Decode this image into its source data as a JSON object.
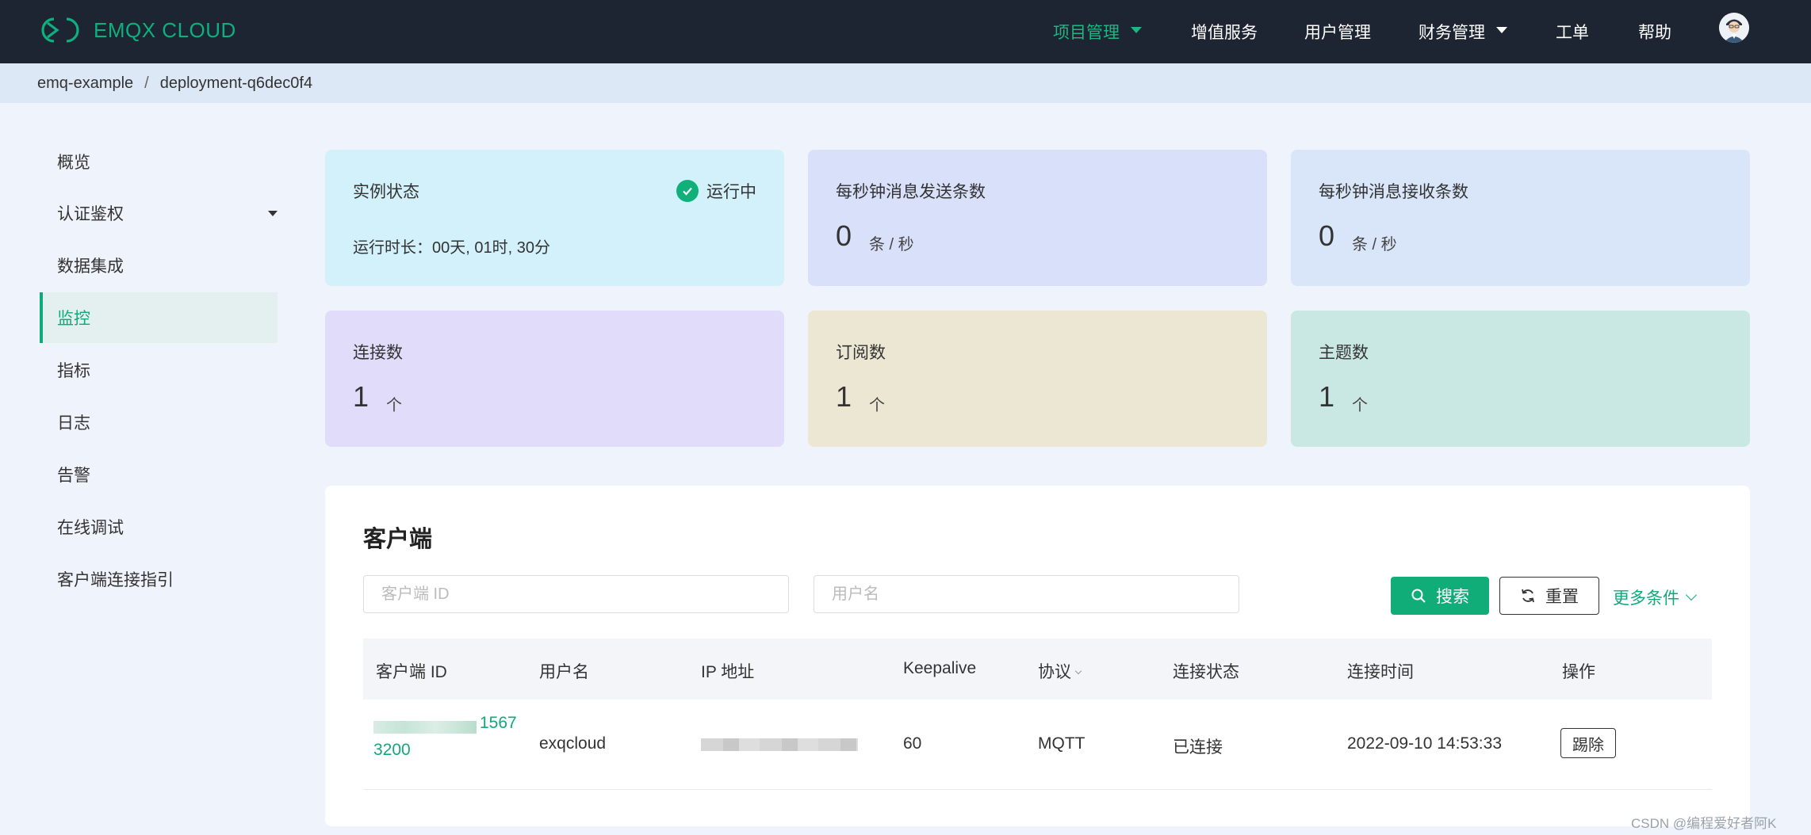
{
  "brand": {
    "name": "EMQX CLOUD",
    "color": "#0db07e"
  },
  "nav": {
    "items": [
      {
        "label": "项目管理",
        "dropdown": true,
        "active": true
      },
      {
        "label": "增值服务",
        "dropdown": false
      },
      {
        "label": "用户管理",
        "dropdown": false
      },
      {
        "label": "财务管理",
        "dropdown": true
      },
      {
        "label": "工单",
        "dropdown": false
      },
      {
        "label": "帮助",
        "dropdown": false
      }
    ]
  },
  "breadcrumb": {
    "project": "emq-example",
    "separator": "/",
    "deployment": "deployment-q6dec0f4"
  },
  "sidebar": {
    "items": [
      {
        "label": "概览"
      },
      {
        "label": "认证鉴权",
        "dropdown": true
      },
      {
        "label": "数据集成"
      },
      {
        "label": "监控",
        "active": true
      },
      {
        "label": "指标"
      },
      {
        "label": "日志"
      },
      {
        "label": "告警"
      },
      {
        "label": "在线调试"
      },
      {
        "label": "客户端连接指引"
      }
    ]
  },
  "cards": {
    "instance": {
      "title": "实例状态",
      "status": "运行中",
      "uptime": "运行时长：00天, 01时, 30分",
      "color": "#d3f1fa"
    },
    "send_rate": {
      "title": "每秒钟消息发送条数",
      "value": "0",
      "unit": "条 / 秒",
      "color": "#d9e0fa"
    },
    "recv_rate": {
      "title": "每秒钟消息接收条数",
      "value": "0",
      "unit": "条 / 秒",
      "color": "#d9e6fa"
    },
    "connections": {
      "title": "连接数",
      "value": "1",
      "unit": "个",
      "color": "#e0dcfa"
    },
    "subscriptions": {
      "title": "订阅数",
      "value": "1",
      "unit": "个",
      "color": "#ebe7d3"
    },
    "topics": {
      "title": "主题数",
      "value": "1",
      "unit": "个",
      "color": "#cae8e3"
    }
  },
  "clients": {
    "title": "客户端",
    "client_id_placeholder": "客户端 ID",
    "username_placeholder": "用户名",
    "search_label": "搜索",
    "reset_label": "重置",
    "more_label": "更多条件",
    "columns": [
      "客户端 ID",
      "用户名",
      "IP 地址",
      "Keepalive",
      "协议",
      "连接状态",
      "连接时间",
      "操作"
    ],
    "rows": [
      {
        "client_id_suffix_1": "1567",
        "client_id_suffix_2": "3200",
        "username": "exqcloud",
        "keepalive": "60",
        "protocol": "MQTT",
        "state": "已连接",
        "connected_at": "2022-09-10 14:53:33",
        "action": "踢除"
      }
    ]
  },
  "watermark": "CSDN @编程爱好者阿K"
}
